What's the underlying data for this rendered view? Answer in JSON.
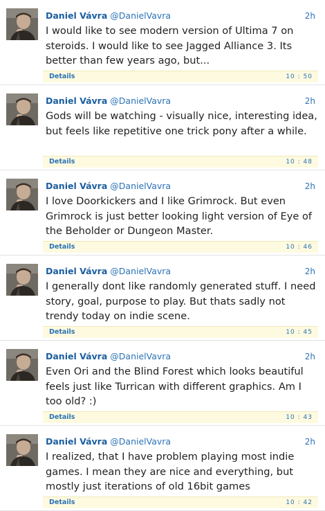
{
  "tweets": [
    {
      "author": "Daniel Vávra",
      "handle": "@DanielVavra",
      "age": "2h",
      "text": "I would like to see modern version of Ultima 7 on steroids. I would like to see Jagged Alliance 3. Its better than few years ago, but...",
      "details": "Details",
      "time": "10 : 50"
    },
    {
      "author": "Daniel Vávra",
      "handle": "@DanielVavra",
      "age": "2h",
      "text": "Gods will be watching - visually nice, interesting idea, but feels like repetitive one trick pony after a while.",
      "details": "Details",
      "time": "10 : 48"
    },
    {
      "author": "Daniel Vávra",
      "handle": "@DanielVavra",
      "age": "2h",
      "text": "I love Doorkickers and I like Grimrock. But even Grimrock is just better looking light version of Eye of the Beholder or Dungeon Master.",
      "details": "Details",
      "time": "10 : 46"
    },
    {
      "author": "Daniel Vávra",
      "handle": "@DanielVavra",
      "age": "2h",
      "text": "I generally dont like randomly generated stuff. I need story, goal, purpose to play. But thats sadly not trendy today on indie scene.",
      "details": "Details",
      "time": "10 : 45"
    },
    {
      "author": "Daniel Vávra",
      "handle": "@DanielVavra",
      "age": "2h",
      "text": "Even Ori and the Blind Forest which looks beautiful feels just like Turrican with different graphics. Am I too old? :)",
      "details": "Details",
      "time": "10 : 43"
    },
    {
      "author": "Daniel Vávra",
      "handle": "@DanielVavra",
      "age": "2h",
      "text": "I realized, that I have problem playing most indie games. I mean they are nice and everything, but mostly just iterations of old 16bit games",
      "details": "Details",
      "time": "10 : 42"
    }
  ],
  "colors": {
    "name": "#1b5e9f",
    "link": "#2b72b6",
    "text": "#222222",
    "details_bar": "#fdfae0"
  }
}
